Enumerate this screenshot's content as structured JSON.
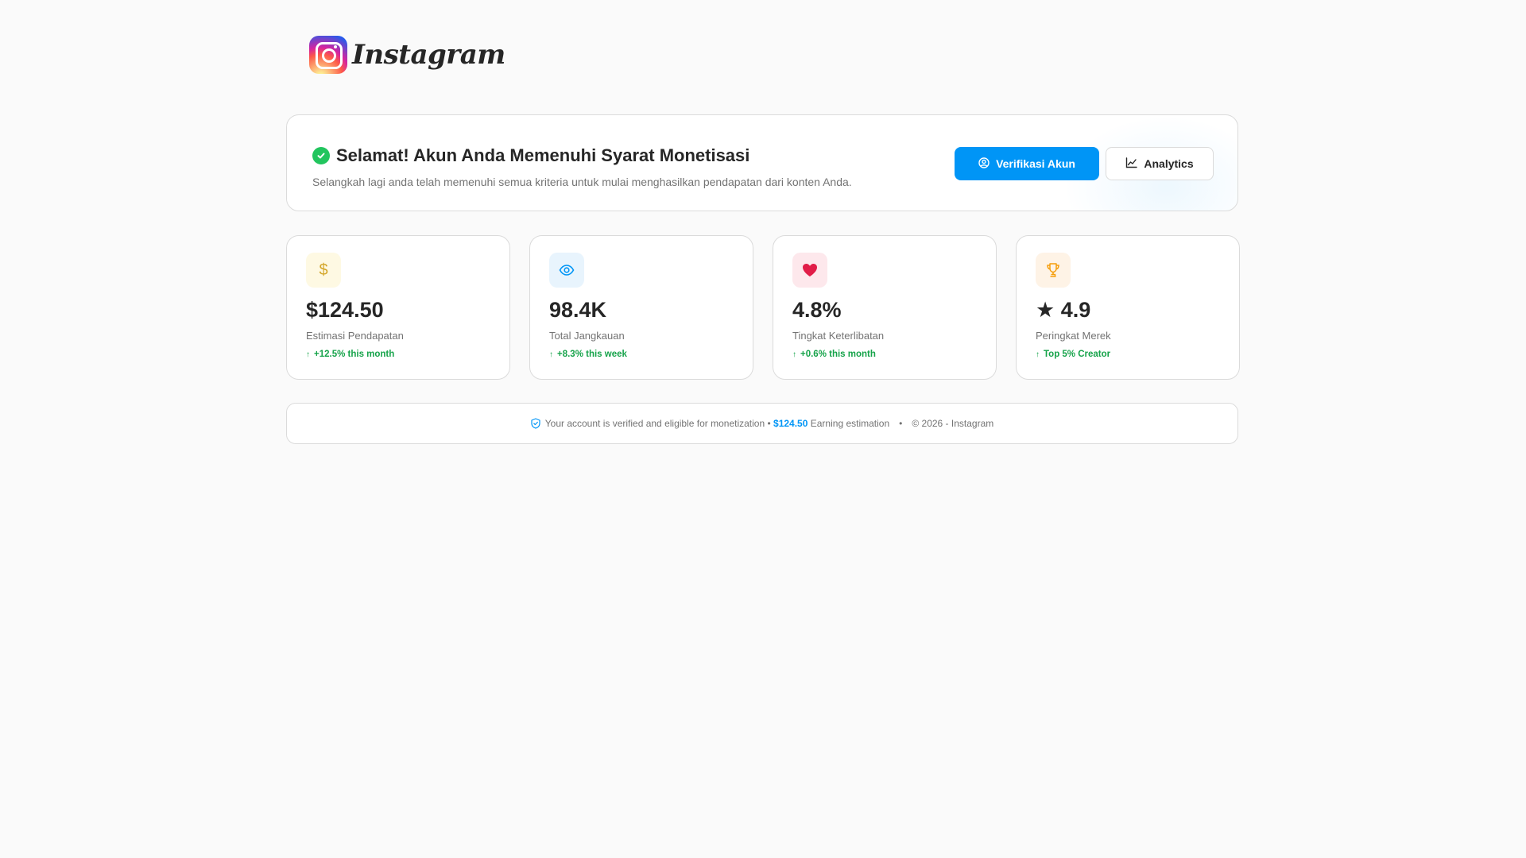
{
  "brand": {
    "name": "Instagram"
  },
  "banner": {
    "title": "Selamat! Akun Anda Memenuhi Syarat Monetisasi",
    "subtitle": "Selangkah lagi anda telah memenuhi semua kriteria untuk mulai menghasilkan pendapatan dari konten Anda.",
    "primary_button": "Verifikasi Akun",
    "secondary_button": "Analytics"
  },
  "stats": [
    {
      "icon": "dollar-icon",
      "value": "$124.50",
      "label": "Estimasi Pendapatan",
      "trend": "+12.5% this month",
      "color": "#d4a72c",
      "bg": "#fef9e3"
    },
    {
      "icon": "eye-icon",
      "value": "98.4K",
      "label": "Total Jangkauan",
      "trend": "+8.3% this week",
      "color": "#0095f6",
      "bg": "#e8f4fd"
    },
    {
      "icon": "heart-icon",
      "value": "4.8%",
      "label": "Tingkat Keterlibatan",
      "trend": "+0.6% this month",
      "color": "#e11d48",
      "bg": "#fde8ec"
    },
    {
      "icon": "trophy-icon",
      "value": "★ 4.9",
      "label": "Peringkat Merek",
      "trend": "Top 5% Creator",
      "color": "#f59e0b",
      "bg": "#fef3e6"
    }
  ],
  "footer": {
    "verified_text": "Your account is verified and eligible for monetization •",
    "amount": "$124.50",
    "amount_label": "Earning estimation",
    "bullet": "•",
    "copyright": "© 2026 - Instagram"
  },
  "colors": {
    "accent": "#0095f6",
    "success": "#22c55e",
    "trend": "#16a34a"
  }
}
